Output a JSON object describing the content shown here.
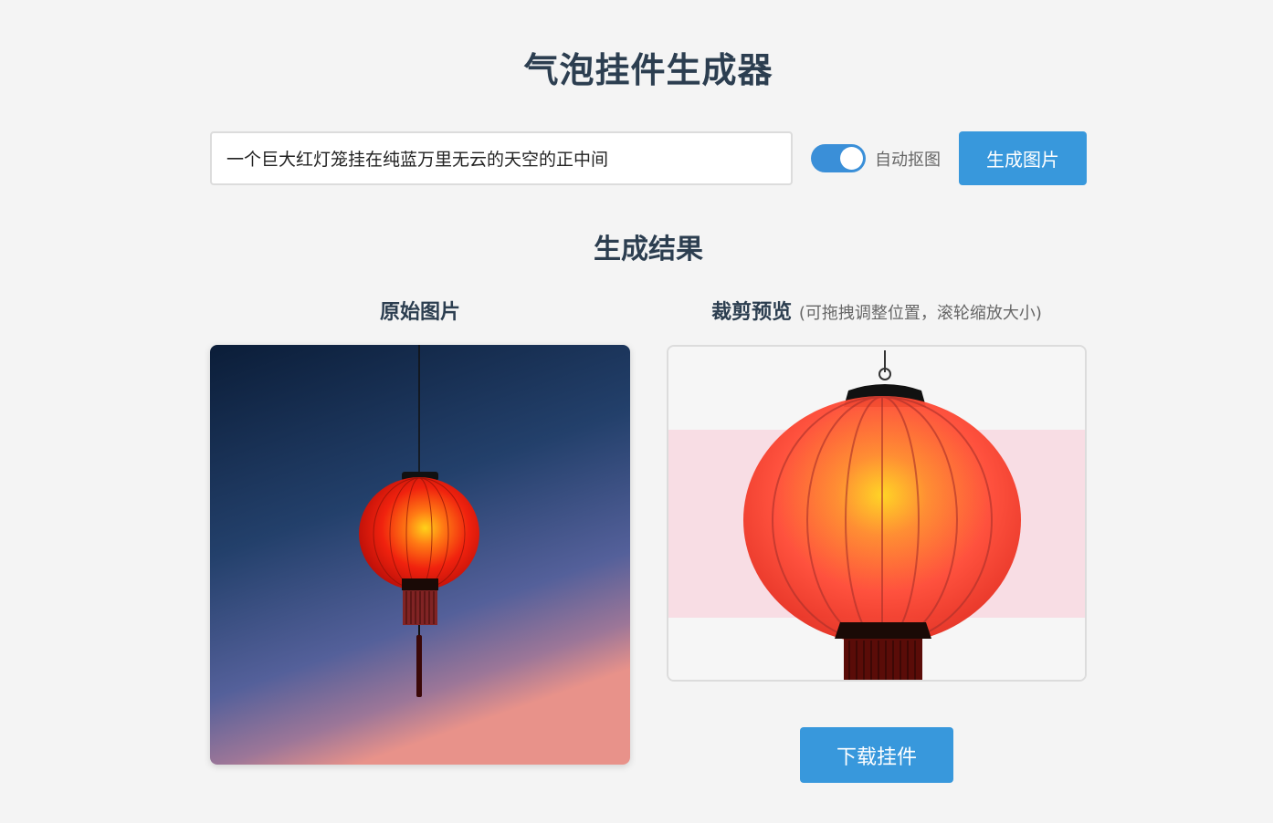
{
  "header": {
    "title": "气泡挂件生成器"
  },
  "form": {
    "prompt_value": "一个巨大红灯笼挂在纯蓝万里无云的天空的正中间",
    "auto_cutout_label": "自动抠图",
    "auto_cutout_on": true,
    "generate_label": "生成图片"
  },
  "results": {
    "title": "生成结果",
    "original_title": "原始图片",
    "crop_title": "裁剪预览",
    "crop_hint": "(可拖拽调整位置，滚轮缩放大小)",
    "download_label": "下载挂件"
  },
  "colors": {
    "accent": "#3898dc",
    "title": "#2c3e50",
    "lantern": "#ff3b1f",
    "sky_top": "#0c1f3c",
    "sky_bottom": "#e8928a",
    "crop_band": "#f8d8e0"
  }
}
